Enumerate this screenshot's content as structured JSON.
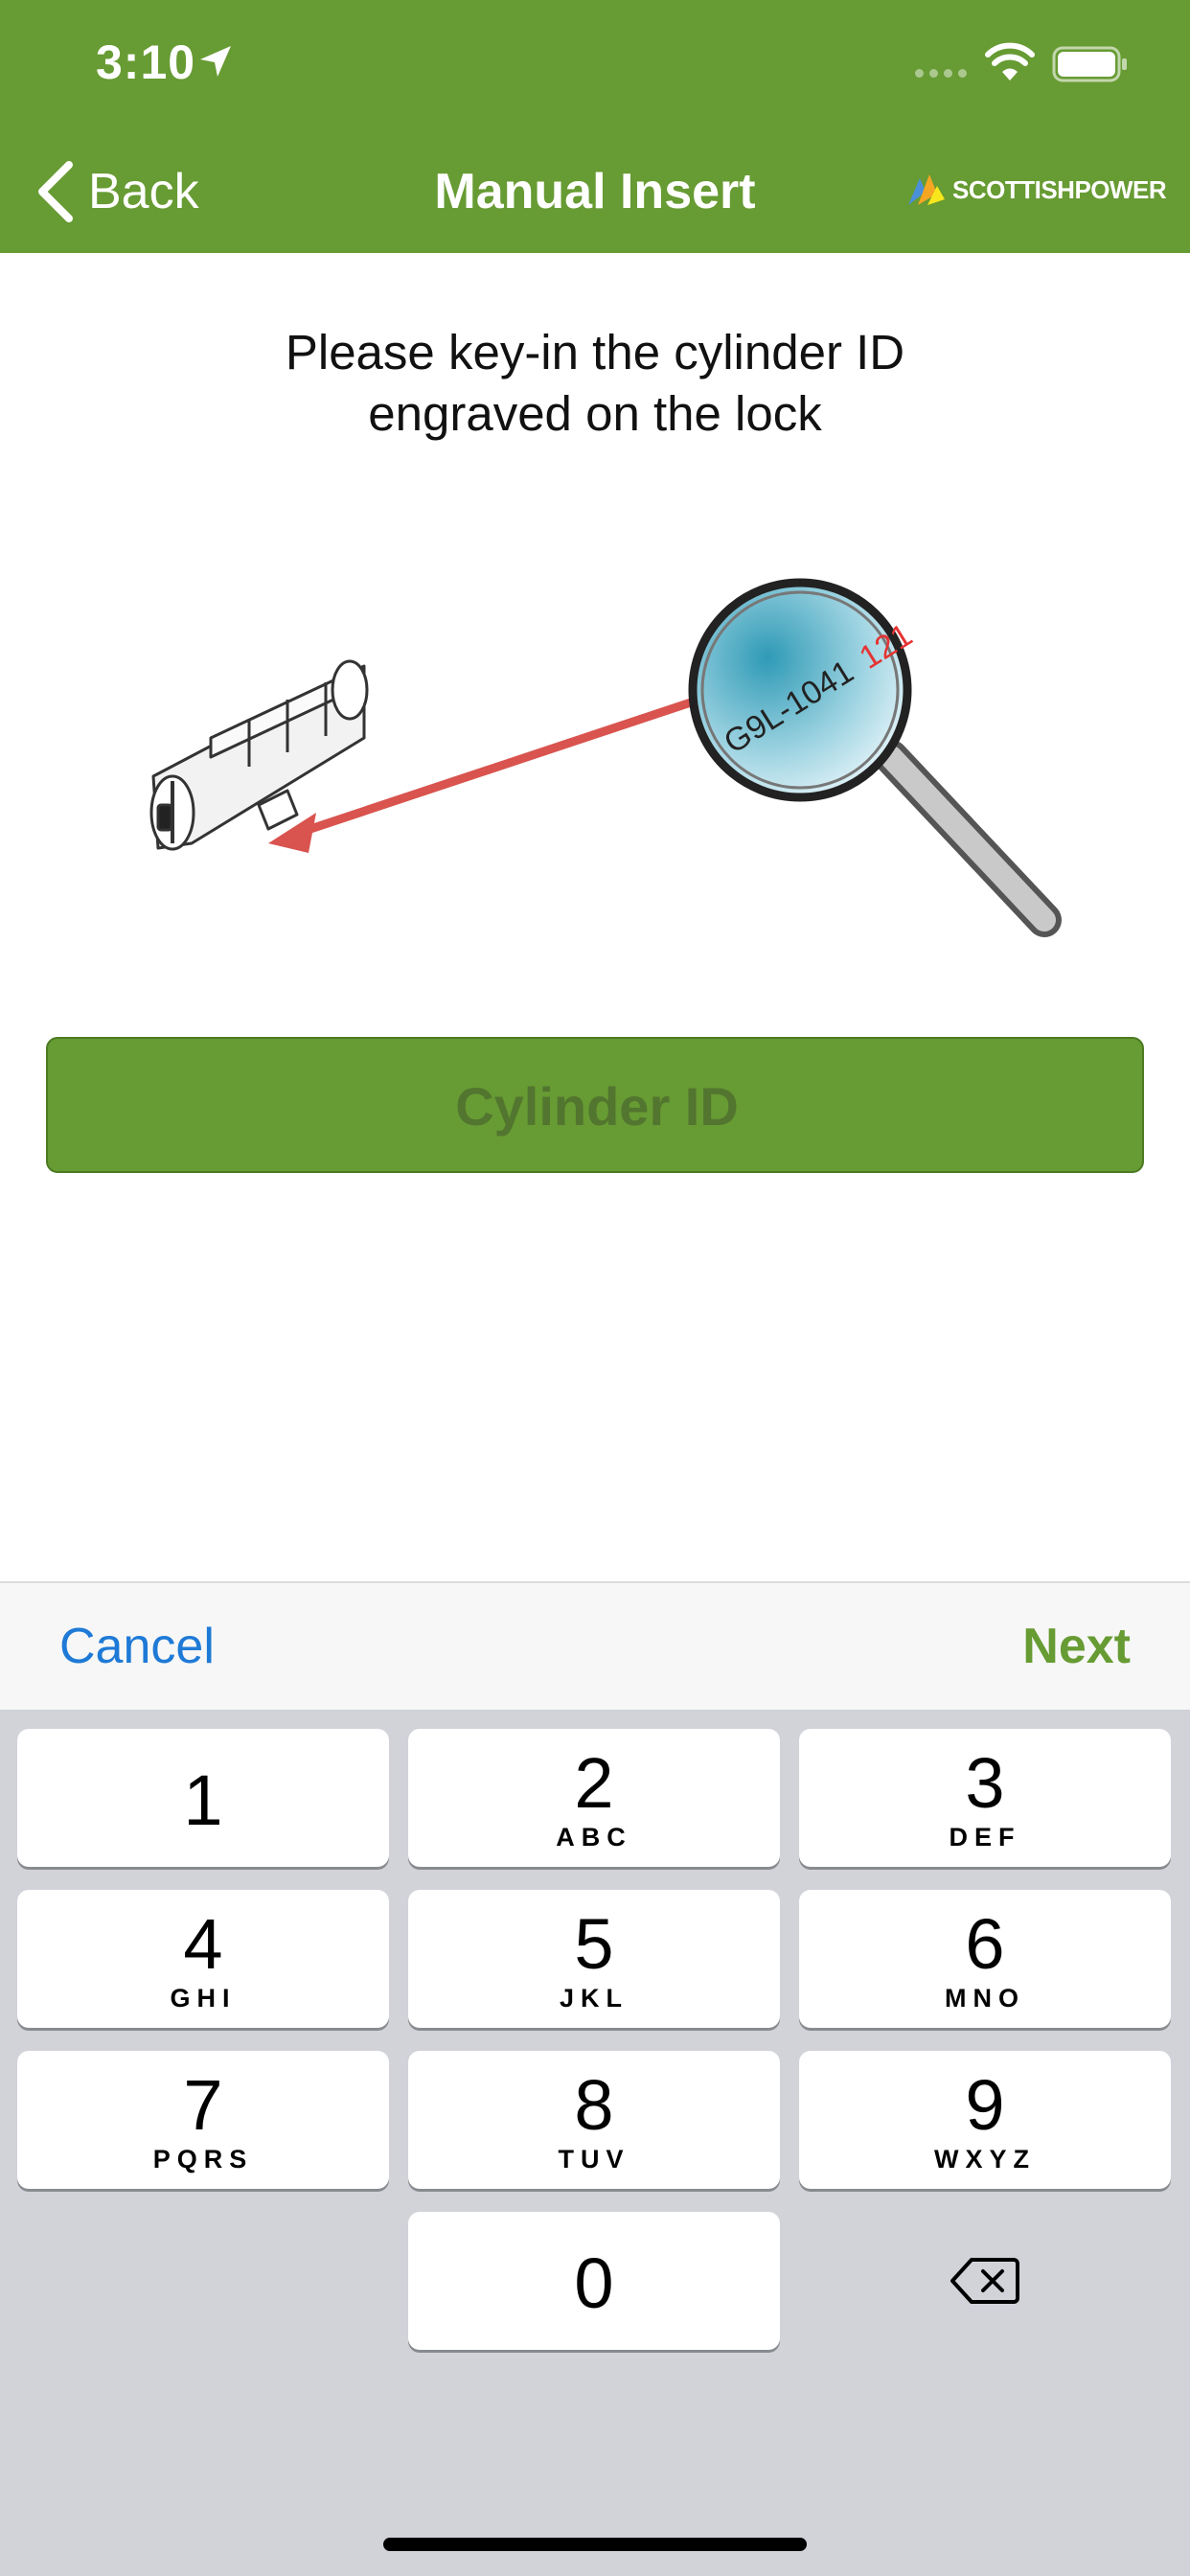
{
  "colors": {
    "brand": "#679b33",
    "link": "#1e7ad6",
    "keyboard_bg": "#d1d3d9"
  },
  "status_bar": {
    "time": "3:10",
    "icons": [
      "location-arrow-icon",
      "signal-dots-icon",
      "wifi-icon",
      "battery-icon"
    ]
  },
  "nav": {
    "back_label": "Back",
    "title": "Manual Insert",
    "brand": "SCOTTISHPOWER"
  },
  "content": {
    "instruction_line1": "Please key-in the cylinder ID",
    "instruction_line2": "engraved on the lock",
    "illustration": {
      "engraving_dark": "G9L-1041",
      "engraving_red": "121"
    },
    "input": {
      "placeholder": "Cylinder ID",
      "value": ""
    }
  },
  "accessory": {
    "cancel_label": "Cancel",
    "next_label": "Next"
  },
  "keypad": {
    "keys": [
      {
        "num": "1",
        "letters": ""
      },
      {
        "num": "2",
        "letters": "ABC"
      },
      {
        "num": "3",
        "letters": "DEF"
      },
      {
        "num": "4",
        "letters": "GHI"
      },
      {
        "num": "5",
        "letters": "JKL"
      },
      {
        "num": "6",
        "letters": "MNO"
      },
      {
        "num": "7",
        "letters": "PQRS"
      },
      {
        "num": "8",
        "letters": "TUV"
      },
      {
        "num": "9",
        "letters": "WXYZ"
      },
      {
        "num": "0",
        "letters": ""
      }
    ],
    "delete_icon": "backspace-icon"
  }
}
